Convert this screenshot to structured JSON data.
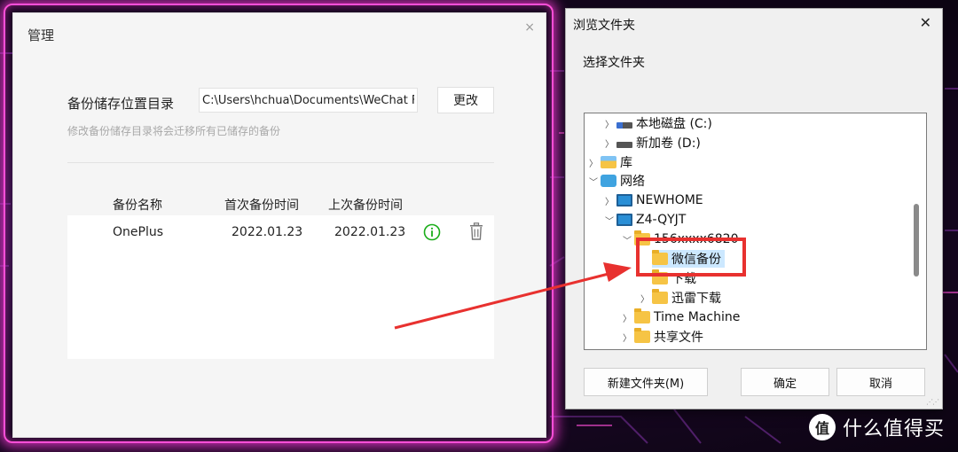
{
  "management": {
    "title": "管理",
    "close_label": "×",
    "path_label": "备份储存位置目录",
    "path_value": "C:\\Users\\hchua\\Documents\\WeChat Fi",
    "change_button": "更改",
    "hint": "修改备份储存目录将会迁移所有已储存的备份",
    "table": {
      "headers": [
        "备份名称",
        "首次备份时间",
        "上次备份时间"
      ],
      "rows": [
        {
          "name": "OnePlus",
          "first": "2022.01.23",
          "last": "2022.01.23"
        }
      ]
    },
    "icons": {
      "info": "info-circle-icon",
      "delete": "trash-icon"
    },
    "accent_color": "#1aad19"
  },
  "browse_dialog": {
    "title": "浏览文件夹",
    "close_label": "✕",
    "subtitle": "选择文件夹",
    "tree": [
      {
        "label": "本地磁盘 (C:)",
        "icon": "drive-icon",
        "expanded": false
      },
      {
        "label": "新加卷 (D:)",
        "icon": "drive-icon",
        "expanded": false
      },
      {
        "label": "库",
        "icon": "library-icon",
        "expanded": false
      },
      {
        "label": "网络",
        "icon": "network-icon",
        "expanded": true
      },
      {
        "label": "NEWHOME",
        "icon": "computer-icon",
        "expanded": false
      },
      {
        "label": "Z4-QYJT",
        "icon": "computer-icon",
        "expanded": true
      },
      {
        "label": "156xxxx6820",
        "icon": "folder-icon",
        "expanded": true
      },
      {
        "label": "微信备份",
        "icon": "folder-icon",
        "selected": true
      },
      {
        "label": "下载",
        "icon": "folder-icon"
      },
      {
        "label": "迅雷下载",
        "icon": "folder-icon",
        "expanded": false
      },
      {
        "label": "Time Machine",
        "icon": "folder-icon",
        "expanded": false
      },
      {
        "label": "共享文件",
        "icon": "folder-icon",
        "expanded": false
      }
    ],
    "buttons": {
      "new_folder": "新建文件夹(M)",
      "ok": "确定",
      "cancel": "取消"
    },
    "selection_color": "#cce8ff"
  },
  "annotation": {
    "highlight_color": "#e8312f"
  },
  "watermark": {
    "badge": "值",
    "text": "什么值得买"
  }
}
